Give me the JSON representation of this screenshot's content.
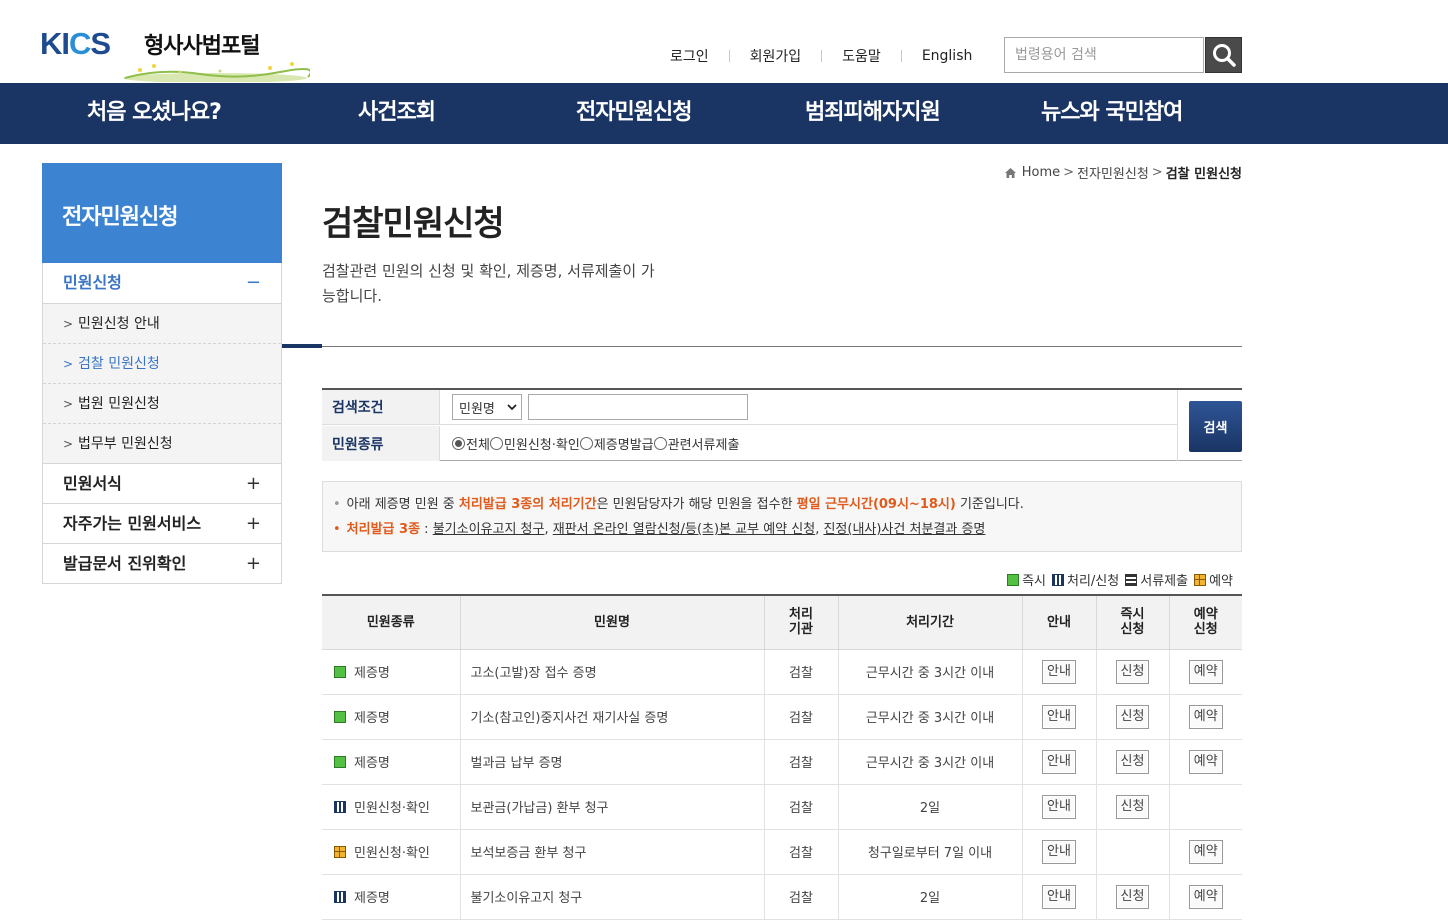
{
  "site": {
    "logo_brand": "KICS",
    "logo_title": "형사사법포털"
  },
  "util_links": [
    "로그인",
    "회원가입",
    "도움말",
    "English"
  ],
  "search": {
    "placeholder": "법령용어 검색"
  },
  "gnb": [
    "처음 오셨나요?",
    "사건조회",
    "전자민원신청",
    "범죄피해자지원",
    "뉴스와 국민참여"
  ],
  "lnb": {
    "title": "전자민원신청",
    "group_active": "민원신청",
    "sub_items": [
      "민원신청 안내",
      "검찰 민원신청",
      "법원 민원신청",
      "법무부 민원신청"
    ],
    "other_groups": [
      "민원서식",
      "자주가는 민원서비스",
      "발급문서 진위확인"
    ]
  },
  "breadcrumb": {
    "home": "Home",
    "level1": "전자민원신청",
    "current": "검찰 민원신청"
  },
  "page": {
    "title": "검찰민원신청",
    "desc": "검찰관련 민원의 신청 및 확인, 제증명, 서류제출이 가능합니다."
  },
  "search_form": {
    "cond_label": "검색조건",
    "cond_select": "민원명",
    "cond_value": "",
    "type_label": "민원종류",
    "radios": [
      "전체",
      "민원신청·확인",
      "제증명발급",
      "관련서류제출"
    ],
    "radio_selected": 0,
    "button": "검색"
  },
  "notice": {
    "line1_pre": "아래 제증명 민원 중 ",
    "line1_em": "처리발급 3종의 처리기간",
    "line1_mid": "은 민원담당자가 해당 민원을 접수한 ",
    "line1_em2": "평일 근무시간(09시~18시)",
    "line1_post": " 기준입니다.",
    "line2_em": "처리발급 3종",
    "line2_sep": " : ",
    "line2_links": [
      "불기소이유고지 청구",
      "재판서 온라인 열람신청/등(초)본 교부 예약 신청",
      "진정(내사)사건 처분결과 증명"
    ],
    "line2_comma": ", "
  },
  "legend": [
    "즉시",
    "처리/신청",
    "서류제출",
    "예약"
  ],
  "table": {
    "headers": [
      "민원종류",
      "민원명",
      "처리기관",
      "처리기간",
      "안내",
      "즉시신청",
      "예약신청"
    ],
    "header_lines": {
      "h2a": "처리",
      "h2b": "기관",
      "h5a": "즉시",
      "h5b": "신청",
      "h6a": "예약",
      "h6b": "신청"
    },
    "btn_guide": "안내",
    "btn_apply": "신청",
    "btn_reserve": "예약",
    "rows": [
      {
        "icon": "now",
        "type": "제증명",
        "name": "고소(고발)장 접수 증명",
        "org": "검찰",
        "period": "근무시간 중 3시간 이내"
      },
      {
        "icon": "now",
        "type": "제증명",
        "name": "기소(참고인)중지사건 재기사실 증명",
        "org": "검찰",
        "period": "근무시간 중 3시간 이내"
      },
      {
        "icon": "now",
        "type": "제증명",
        "name": "벌과금 납부 증명",
        "org": "검찰",
        "period": "근무시간 중 3시간 이내"
      },
      {
        "icon": "proc",
        "type": "민원신청·확인",
        "name": "보관금(가납금) 환부 청구",
        "org": "검찰",
        "period": "2일"
      },
      {
        "icon": "resv",
        "type": "민원신청·확인",
        "name": "보석보증금 환부 청구",
        "org": "검찰",
        "period": "청구일로부터 7일 이내"
      },
      {
        "icon": "proc",
        "type": "제증명",
        "name": "불기소이유고지 청구",
        "org": "검찰",
        "period": "2일"
      }
    ]
  },
  "colors": {
    "navy": "#1a3464",
    "lnb_blue": "#3c83d2",
    "accent_orange": "#e05a1c"
  },
  "icons": [
    "search-icon",
    "home-icon",
    "chevron-right-icon",
    "minus-icon",
    "plus-icon",
    "chevron-down-icon"
  ]
}
